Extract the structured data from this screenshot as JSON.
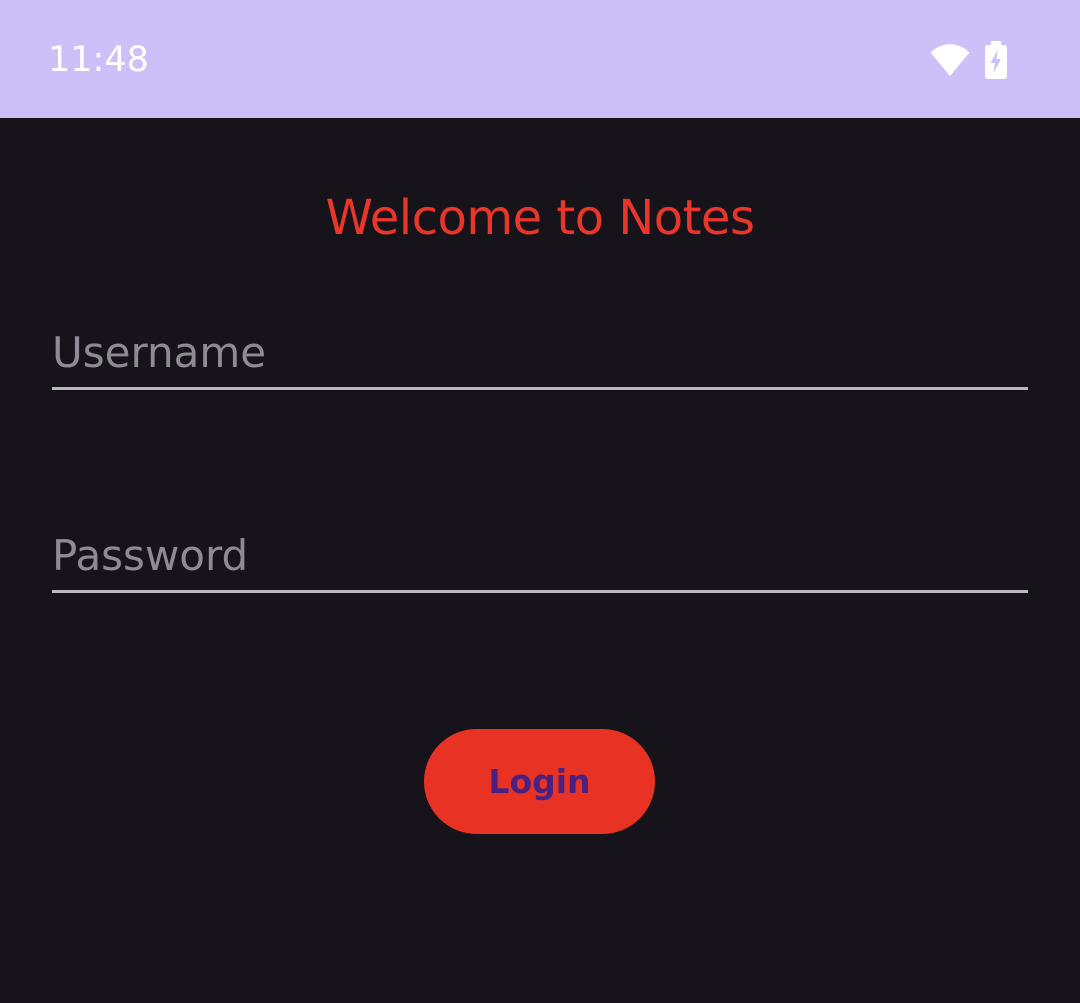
{
  "status_bar": {
    "time": "11:48",
    "icons": [
      "wifi-icon",
      "battery-charging-icon"
    ],
    "background": "#cdc0f8"
  },
  "screen": {
    "background": "#16131a",
    "title": "Welcome to Notes",
    "title_color": "#e8362b"
  },
  "form": {
    "username_placeholder": "Username",
    "username_value": "",
    "password_placeholder": "Password",
    "password_value": "",
    "login_label": "Login",
    "login_background": "#e83324",
    "login_text_color": "#4a2180"
  }
}
